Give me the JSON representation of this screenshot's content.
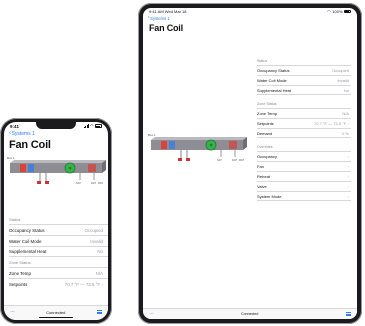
{
  "status_bar": {
    "phone_time": "9:41",
    "tablet_time": "9:41 AM  Wed Mar 18",
    "tablet_battery": "100%"
  },
  "nav": {
    "back_label": "Systems 1",
    "title": "Fan Coil"
  },
  "schematic": {
    "label_top_left": "Box 1",
    "labels": [
      "SAT",
      "DAT",
      "RAT"
    ],
    "colors": {
      "duct": "#8d8d93",
      "coil_red": "#d8433a",
      "coil_blue": "#4a7fd8",
      "fan": "#35b24a",
      "fan_outline": "#1e7d31"
    }
  },
  "status_section": {
    "header": "Status",
    "rows": [
      {
        "label": "Occupancy Status",
        "value": "Occupied"
      },
      {
        "label": "Water Coil Mode",
        "value": "Invalid"
      },
      {
        "label": "Supplemental Heat",
        "value": "No"
      }
    ]
  },
  "zone_section": {
    "header": "Zone Status",
    "rows": [
      {
        "label": "Zone Temp",
        "value": "N/A"
      },
      {
        "label": "Setpoints",
        "value": "70.7 °F — 73.5 °F"
      },
      {
        "label": "Demand",
        "value": "0 %"
      }
    ]
  },
  "overrides_section": {
    "header": "Overrides",
    "rows": [
      {
        "label": "Occupancy"
      },
      {
        "label": "Fan"
      },
      {
        "label": "Reheat"
      },
      {
        "label": "Valve"
      },
      {
        "label": "System Mode"
      }
    ]
  },
  "toolbar": {
    "more_icon": "···",
    "status": "Connected",
    "menu_icon": "list-icon"
  },
  "glyphs": {
    "chevron_left": "‹",
    "chevron_right": "›",
    "wifi": "◠"
  }
}
